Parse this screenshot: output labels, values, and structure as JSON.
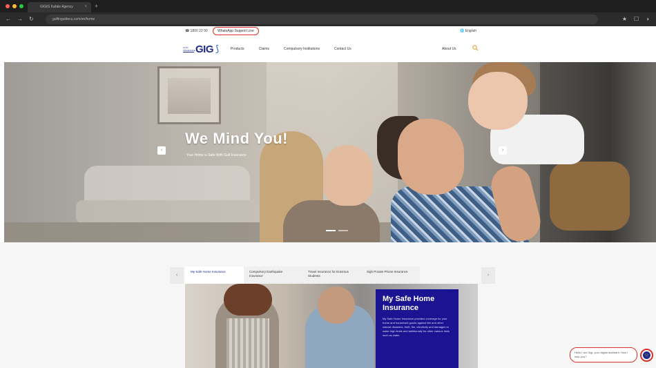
{
  "browser": {
    "tab_title": "GIGIG Kafale Agency",
    "tab_close": "×",
    "new_tab": "+",
    "nav_icons": [
      "←",
      "→",
      "↻"
    ],
    "url": "gulfinguidecu.com/en/home",
    "right_icons": [
      "★",
      "☐",
      "◑"
    ],
    "dot_colors": [
      "#ff5f57",
      "#febc2e",
      "#28c840"
    ]
  },
  "utility_bar": {
    "phone": "☎ 1800 22 90",
    "whatsapp": "WhatsApp Support Line",
    "language": "🌐 English"
  },
  "header": {
    "logo_small": "GULF INSURANCE",
    "logo_text": "GIG",
    "logo_mark": "⟆",
    "nav_items": [
      "Products",
      "Claims",
      "Compulsory Institutions",
      "Contact Us"
    ],
    "about": "About Us"
  },
  "hero": {
    "title": "We Mind You!",
    "subtitle": "Your Home is Safe With Gulf Insurance",
    "prev_arrow": "‹",
    "next_arrow": "›"
  },
  "products": {
    "tabs": [
      "My Safe Home Insurance",
      "Compulsory Earthquake Insurance",
      "Travel Insurance for Erasmus Students",
      "Sigh Private Phone Insurance"
    ],
    "prev_arrow": "‹",
    "next_arrow": "›",
    "card_title": "My Safe Home Insurance",
    "card_desc": "My Safe Home Insurance provides coverage for your home and household goods against fire and other natural disasters, theft, fire, electricity and damages to water high limits and additionally for other various risks such as water"
  },
  "chat": {
    "message": "Hello I am Gigi, your digital assistant. How I help you?",
    "icon": "☺"
  },
  "colors": {
    "brand_blue": "#1c2b8c",
    "promo_navy": "#1a1493",
    "highlight_red": "#d9302c"
  }
}
